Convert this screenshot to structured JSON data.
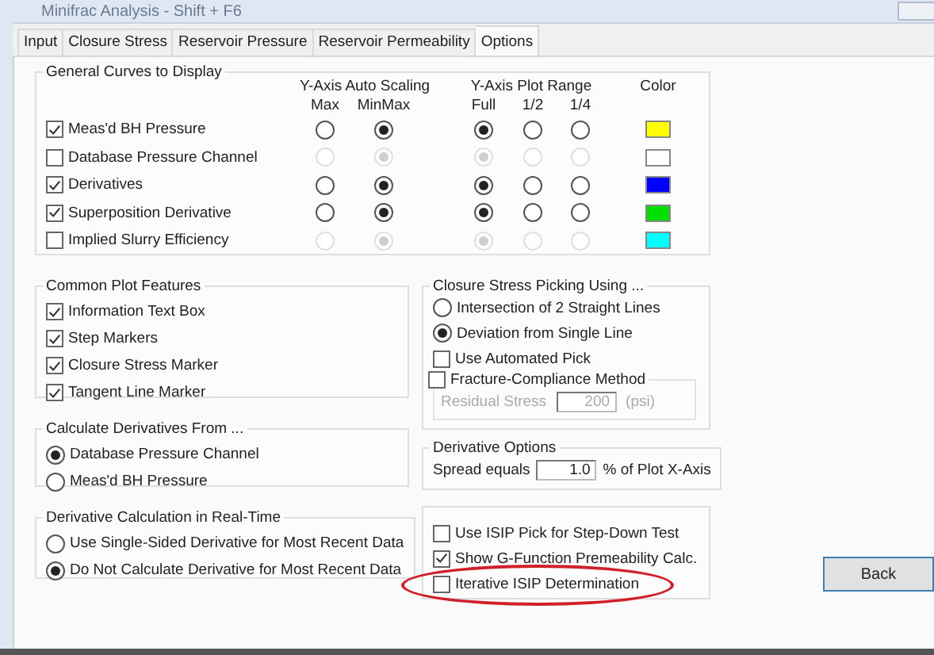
{
  "window": {
    "title": "Minifrac Analysis - Shift + F6"
  },
  "tabs": [
    {
      "label": "Input",
      "selected": false
    },
    {
      "label": "Closure Stress",
      "selected": false
    },
    {
      "label": "Reservoir Pressure",
      "selected": false
    },
    {
      "label": "Reservoir Permeability",
      "selected": false
    },
    {
      "label": "Options",
      "selected": true
    }
  ],
  "general_curves": {
    "title": "General Curves to Display",
    "auto_scaling_header": "Y-Axis Auto Scaling",
    "auto_scaling_columns": [
      "Max",
      "MinMax"
    ],
    "plot_range_header": "Y-Axis Plot Range",
    "plot_range_columns": [
      "Full",
      "1/2",
      "1/4"
    ],
    "color_header": "Color",
    "curves": [
      {
        "label": "Meas'd BH Pressure",
        "checked": true,
        "disabled": false,
        "auto_scaling": [
          {
            "selected": false
          },
          {
            "selected": true
          }
        ],
        "plot_range": [
          {
            "selected": true
          },
          {
            "selected": false
          },
          {
            "selected": false
          }
        ],
        "color": "#ffff00"
      },
      {
        "label": "Database Pressure Channel",
        "checked": false,
        "disabled": true,
        "auto_scaling": [
          {
            "selected": false
          },
          {
            "selected": true
          }
        ],
        "plot_range": [
          {
            "selected": true
          },
          {
            "selected": false
          },
          {
            "selected": false
          }
        ],
        "color": "#ffffff"
      },
      {
        "label": "Derivatives",
        "checked": true,
        "disabled": false,
        "auto_scaling": [
          {
            "selected": false
          },
          {
            "selected": true
          }
        ],
        "plot_range": [
          {
            "selected": true
          },
          {
            "selected": false
          },
          {
            "selected": false
          }
        ],
        "color": "#0000ff"
      },
      {
        "label": "Superposition Derivative",
        "checked": true,
        "disabled": false,
        "auto_scaling": [
          {
            "selected": false
          },
          {
            "selected": true
          }
        ],
        "plot_range": [
          {
            "selected": true
          },
          {
            "selected": false
          },
          {
            "selected": false
          }
        ],
        "color": "#00e000"
      },
      {
        "label": "Implied Slurry Efficiency",
        "checked": false,
        "disabled": true,
        "auto_scaling": [
          {
            "selected": false
          },
          {
            "selected": true
          }
        ],
        "plot_range": [
          {
            "selected": true
          },
          {
            "selected": false
          },
          {
            "selected": false
          }
        ],
        "color": "#00ffff"
      }
    ]
  },
  "common_plot_features": {
    "title": "Common Plot Features",
    "items": [
      {
        "label": "Information Text Box",
        "checked": true
      },
      {
        "label": "Step Markers",
        "checked": true
      },
      {
        "label": "Closure Stress Marker",
        "checked": true
      },
      {
        "label": "Tangent Line Marker",
        "checked": true
      }
    ]
  },
  "calculate_derivatives_from": {
    "title": "Calculate Derivatives From ...",
    "options": [
      {
        "label": "Database Pressure Channel",
        "selected": true
      },
      {
        "label": "Meas'd BH Pressure",
        "selected": false
      }
    ]
  },
  "derivative_calculation": {
    "title": "Derivative Calculation in Real-Time",
    "options": [
      {
        "label": "Use Single-Sided Derivative for Most Recent Data",
        "selected": false
      },
      {
        "label": "Do Not Calculate Derivative for Most Recent Data",
        "selected": true
      }
    ]
  },
  "closure_stress_picking": {
    "title": "Closure Stress Picking Using ...",
    "methods": [
      {
        "label": "Intersection of 2 Straight Lines",
        "selected": false
      },
      {
        "label": "Deviation from Single Line",
        "selected": true
      }
    ],
    "checks": [
      {
        "label": "Use Automated Pick",
        "checked": false
      }
    ],
    "fracture_compliance": {
      "label": "Fracture-Compliance Method",
      "checked": false,
      "residual_stress": {
        "label": "Residual Stress",
        "value": "200",
        "unit": "(psi)",
        "disabled": true
      }
    }
  },
  "derivative_options": {
    "title": "Derivative Options",
    "spread_label": "Spread equals",
    "spread_value": "1.0",
    "spread_unit": "% of Plot X-Axis"
  },
  "isip_options": {
    "items": [
      {
        "label": "Use ISIP Pick for Step-Down Test",
        "checked": false
      },
      {
        "label": "Show G-Function Premeability Calc.",
        "checked": true
      },
      {
        "label": "Iterative ISIP Determination",
        "checked": false
      }
    ]
  },
  "buttons": [
    "Back"
  ]
}
